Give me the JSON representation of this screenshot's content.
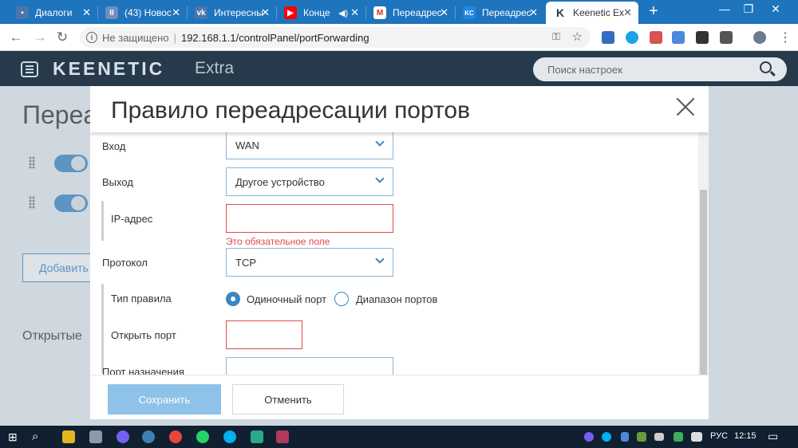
{
  "browser": {
    "tabs": [
      {
        "title": "Диалоги",
        "icon": "chat-icon",
        "color": "#4a76a8"
      },
      {
        "title": "(43) Новос",
        "icon": "pause-icon",
        "color": "#6d8fbd"
      },
      {
        "title": "Интересны",
        "icon": "vk-icon",
        "color": "#4a76a8"
      },
      {
        "title": "Конце",
        "icon": "youtube-icon",
        "color": "#ff0000"
      },
      {
        "title": "Переадрес",
        "icon": "gmail-icon",
        "color": "#d93025"
      },
      {
        "title": "Переадрес",
        "icon": "keenetic-community-icon",
        "color": "#1e88e5"
      },
      {
        "title": "Keenetic Ex",
        "icon": "keenetic-icon",
        "color": "#263a4c",
        "active": true
      }
    ],
    "new_tab": "+",
    "address": {
      "security": "Не защищено",
      "separator": "|",
      "url": "192.168.1.1/controlPanel/portForwarding"
    }
  },
  "app": {
    "logo": "KEENETIC",
    "model": "Extra",
    "search_placeholder": "Поиск настроек"
  },
  "background_page": {
    "title_partial": "Переа",
    "add_button_partial": "Добавить",
    "section_partial": "Открытые"
  },
  "modal": {
    "title": "Правило переадресации портов",
    "fields": {
      "input_label": "Вход",
      "input_value": "WAN",
      "output_label": "Выход",
      "output_value": "Другое устройство",
      "ip_label": "IP-адрес",
      "ip_value": "",
      "ip_error": "Это обязательное поле",
      "protocol_label": "Протокол",
      "protocol_value": "TCP",
      "rule_type_label": "Тип правила",
      "rule_type_options": [
        "Одиночный порт",
        "Диапазон портов"
      ],
      "rule_type_selected": "Одиночный порт",
      "open_port_label": "Открыть порт",
      "open_port_value": "",
      "dest_port_label": "Порт назначения",
      "dest_port_value": ""
    },
    "save_label": "Сохранить",
    "cancel_label": "Отменить"
  },
  "taskbar": {
    "language": "РУС",
    "time": "12:15"
  },
  "colors": {
    "accent": "#3b86c4",
    "error": "#e04a4a",
    "header": "#263a4c",
    "tabbar": "#1e74bd"
  }
}
